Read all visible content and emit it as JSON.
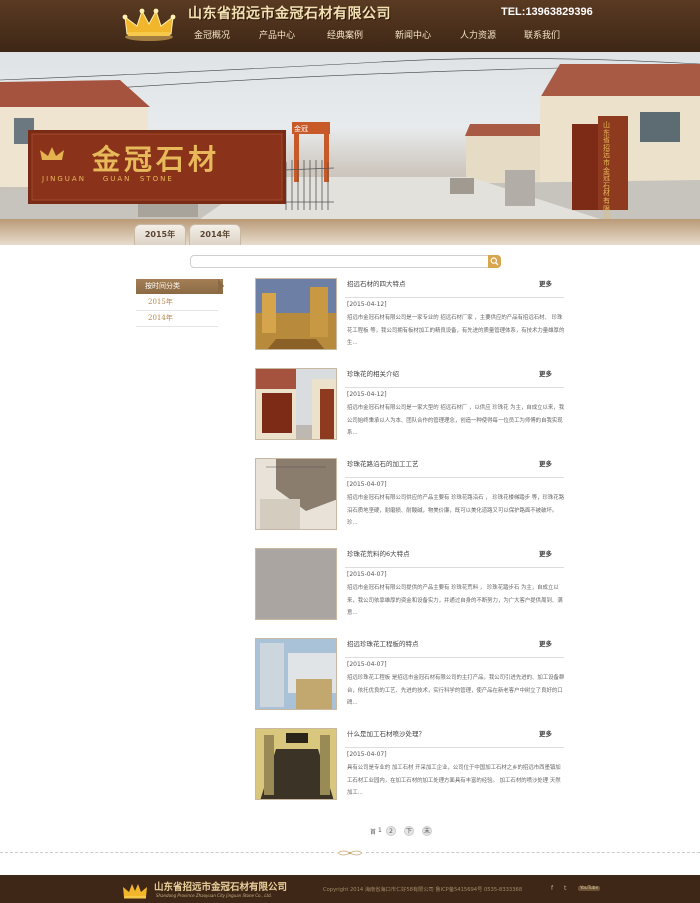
{
  "header": {
    "company_name": "山东省招远市金冠石材有限公司",
    "tel": "TEL:13963829396",
    "nav": [
      "金冠概况",
      "产品中心",
      "经典案例",
      "新闻中心",
      "人力资源",
      "联系我们"
    ]
  },
  "banner": {
    "sign_text": "金冠石材",
    "sign_en": "JINGUAN    GUAN  STONE",
    "gate_text": "山东省招远市金冠石材有限公司",
    "crane_label": "金冠"
  },
  "year_tabs": [
    "2015年",
    "2014年"
  ],
  "search": {
    "placeholder": ""
  },
  "sidebar": {
    "title": "按时间分类",
    "items": [
      "2015年",
      "2014年"
    ]
  },
  "news": [
    {
      "title": "招远石材的四大特点",
      "more": "更多",
      "date": "[2015-04-12]",
      "desc": "招远市金冠石材有限公司是一家专业的 招远石材厂家 ，主要供应的产品有招远石材、 珍珠花工程板 等，我公司拥有板材加工的精良设备，有先进的质量管理体系，有技术力量雄厚的生..."
    },
    {
      "title": "珍珠花的相关介绍",
      "more": "更多",
      "date": "[2015-04-12]",
      "desc": "招远市金冠石材有限公司是一家大型的 招远石材厂 ，以供应 珍珠花 为主，自成立以来，我公司始终秉承以人为本、团队合作的管理理念，创造一种使得每一位员工为师傅的自我实现系..."
    },
    {
      "title": "珍珠花路沿石的加工工艺",
      "more": "更多",
      "date": "[2015-04-07]",
      "desc": "招远市金冠石材有限公司供应的产品主要有 珍珠花路沿石 ， 珍珠花楼梯踏步 等，珍珠花路沿石质地坚硬，耐磨损、耐酸碱，物美价廉，既可以美化道路又可以保护路面不被破坏。 珍..."
    },
    {
      "title": "珍珠花荒料的6大特点",
      "more": "更多",
      "date": "[2015-04-07]",
      "desc": "招远市金冠石材有限公司提供的产品主要有 珍珠花荒料 ， 珍珠花踏步石 为主，自成立以来，我公司依靠雄厚的资金和设备实力，并通过自身的不断努力，为广大客户提供周到、满意..."
    },
    {
      "title": "招远珍珠花工程板的特点",
      "more": "更多",
      "date": "[2015-04-07]",
      "desc": "招远珍珠花工程板 是招远市金冠石材有限公司的主打产品，我公司引进先进的、加工设备群台，依托优良的工艺、先进的技术，实行科学的管理，使产品在新老客户中树立了良好的口碑..."
    },
    {
      "title": "什么是加工石材喷沙处理？",
      "more": "更多",
      "date": "[2015-04-07]",
      "desc": "具有公司是专业的 加工石材 开采加工企业，公司位于中国加工石材之乡的招远市西墨镇加工石材工业园内，在加工石材的加工处理方面具有丰富的经验。 加工石材的喷沙处理 天然加工..."
    }
  ],
  "pagination": {
    "first": "首",
    "current": "1",
    "page2": "2",
    "next": "下",
    "last": "末"
  },
  "footer": {
    "company_name": "山东省招远市金冠石材有限公司",
    "company_en": "Shandong Province Zhaoyuan City Jinguan Stone Co., Ltd.",
    "copyright": "Copyright 2014 海南省海口市仁好58有限公司  鲁ICP备5415694号  0535-8333368",
    "social": [
      "f",
      "t",
      "YouTube"
    ]
  },
  "colors": {
    "header_bg": "#4a2f1b",
    "accent_gold": "#b8874d",
    "footer_bg": "#3e2716"
  }
}
